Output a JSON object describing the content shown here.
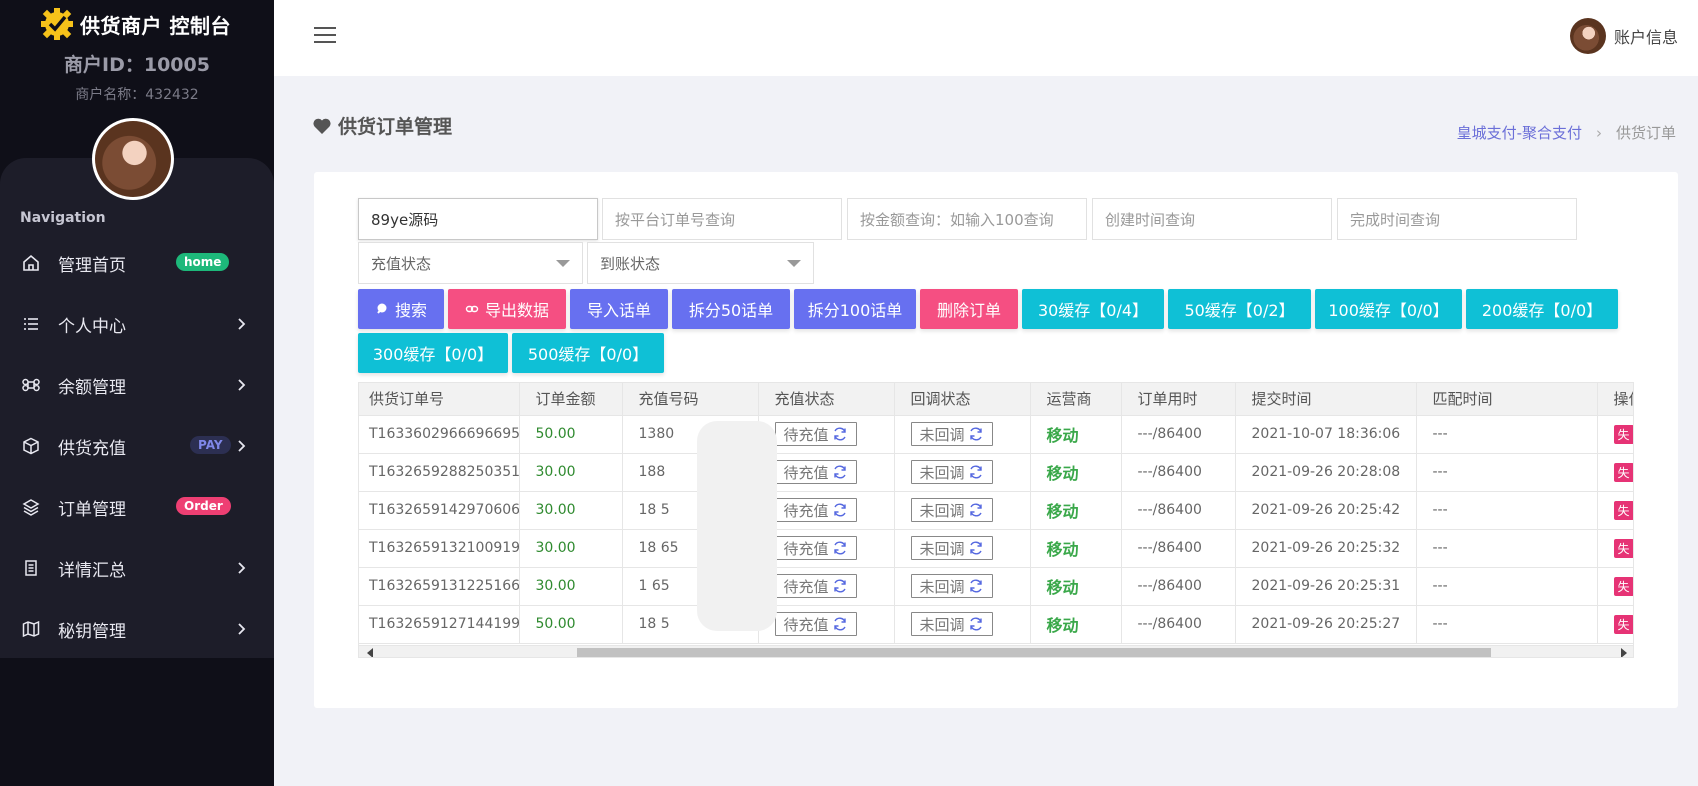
{
  "brand": {
    "title": "供货商户 控制台",
    "logo_icon": "gear-check-icon",
    "logo_color": "#f6c21a"
  },
  "merchant": {
    "id_text": "商户ID：10005",
    "name_text": "商户名称：432432"
  },
  "nav": {
    "heading": "Navigation",
    "items": [
      {
        "label": "管理首页",
        "icon": "home-icon",
        "badge": "home",
        "badge_color": "#1db87a",
        "chevron": false
      },
      {
        "label": "个人中心",
        "icon": "list-icon",
        "badge": "",
        "chevron": true
      },
      {
        "label": "余额管理",
        "icon": "command-icon",
        "badge": "",
        "chevron": true
      },
      {
        "label": "供货充值",
        "icon": "box-icon",
        "badge": "PAY",
        "badge_color": "#2c2f52",
        "chevron": true
      },
      {
        "label": "订单管理",
        "icon": "layers-icon",
        "badge": "Order",
        "badge_color": "#ee3f73",
        "chevron": false
      },
      {
        "label": "详情汇总",
        "icon": "document-icon",
        "badge": "",
        "chevron": true
      },
      {
        "label": "秘钥管理",
        "icon": "map-icon",
        "badge": "",
        "chevron": true
      }
    ]
  },
  "topbar": {
    "account_label": "账户信息"
  },
  "page": {
    "title": "供货订单管理",
    "breadcrumb": {
      "link": "皇城支付-聚合支付",
      "current": "供货订单"
    }
  },
  "filters": {
    "order_no_value": "89ye源码",
    "platform_order_placeholder": "按平台订单号查询",
    "amount_placeholder": "按金额查询：如输入100查询",
    "create_time_placeholder": "创建时间查询",
    "finish_time_placeholder": "完成时间查询",
    "recharge_status": "充值状态",
    "settle_status": "到账状态"
  },
  "buttons": {
    "search": "搜索",
    "export": "导出数据",
    "import": "导入话单",
    "split50": "拆分50话单",
    "split100": "拆分100话单",
    "delete": "删除订单",
    "cache30": "30缓存【0/4】",
    "cache50": "50缓存【0/2】",
    "cache100": "100缓存【0/0】",
    "cache200": "200缓存【0/0】",
    "cache300": "300缓存【0/0】",
    "cache500": "500缓存【0/0】"
  },
  "table": {
    "headers": [
      "供货订单号",
      "订单金额",
      "充值号码",
      "充值状态",
      "回调状态",
      "运营商",
      "订单用时",
      "提交时间",
      "匹配时间",
      "操作"
    ],
    "rows": [
      {
        "order_no": "T1633602966696695",
        "amount": "50.00",
        "phone": "1380",
        "recharge": "待充值",
        "callback": "未回调",
        "carrier": "移动",
        "duration": "---/86400",
        "submit": "2021-10-07 18:36:06",
        "match": "---",
        "op": "失"
      },
      {
        "order_no": "T1632659288250351",
        "amount": "30.00",
        "phone": "188",
        "recharge": "待充值",
        "callback": "未回调",
        "carrier": "移动",
        "duration": "---/86400",
        "submit": "2021-09-26 20:28:08",
        "match": "---",
        "op": "失"
      },
      {
        "order_no": "T1632659142970606",
        "amount": "30.00",
        "phone": "18       5",
        "recharge": "待充值",
        "callback": "未回调",
        "carrier": "移动",
        "duration": "---/86400",
        "submit": "2021-09-26 20:25:42",
        "match": "---",
        "op": "失"
      },
      {
        "order_no": "T1632659132100919",
        "amount": "30.00",
        "phone": "18        65",
        "recharge": "待充值",
        "callback": "未回调",
        "carrier": "移动",
        "duration": "---/86400",
        "submit": "2021-09-26 20:25:32",
        "match": "---",
        "op": "失"
      },
      {
        "order_no": "T1632659131225166",
        "amount": "30.00",
        "phone": "1        65",
        "recharge": "待充值",
        "callback": "未回调",
        "carrier": "移动",
        "duration": "---/86400",
        "submit": "2021-09-26 20:25:31",
        "match": "---",
        "op": "失"
      },
      {
        "order_no": "T1632659127144199",
        "amount": "50.00",
        "phone": "18        5",
        "recharge": "待充值",
        "callback": "未回调",
        "carrier": "移动",
        "duration": "---/86400",
        "submit": "2021-09-26 20:25:27",
        "match": "---",
        "op": "失"
      }
    ]
  },
  "colors": {
    "accent_purple": "#6770f0",
    "accent_pink": "#f54f82",
    "accent_cyan": "#0fc0d6",
    "sidebar_bg": "#0f0f18"
  }
}
